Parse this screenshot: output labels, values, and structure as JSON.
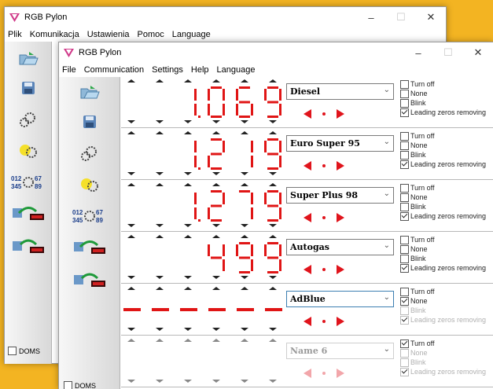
{
  "back_window": {
    "title": "RGB Pylon",
    "menu": [
      "Plik",
      "Komunikacja",
      "Ustawienia",
      "Pomoc",
      "Language"
    ],
    "doms_label": "DOMS"
  },
  "front_window": {
    "title": "RGB Pylon",
    "menu": [
      "File",
      "Communication",
      "Settings",
      "Help",
      "Language"
    ],
    "doms_label": "DOMS",
    "tools": [
      "open-folder-icon",
      "save-disk-icon",
      "settings-gears-icon",
      "bulb-gear-icon",
      "numeric-gear-icon",
      "send-to-display-icon",
      "read-from-display-icon"
    ],
    "rows": [
      {
        "price": "1.069",
        "fuel": "Diesel",
        "turn_off": false,
        "none": false,
        "blink": false,
        "leading_zeros": true,
        "enabled": true,
        "digits": true
      },
      {
        "price": "1.219",
        "fuel": "Euro Super 95",
        "turn_off": false,
        "none": false,
        "blink": false,
        "leading_zeros": true,
        "enabled": true,
        "digits": true
      },
      {
        "price": "1.279",
        "fuel": "Super Plus 98",
        "turn_off": false,
        "none": false,
        "blink": false,
        "leading_zeros": true,
        "enabled": true,
        "digits": true
      },
      {
        "price": "499",
        "fuel": "Autogas",
        "turn_off": false,
        "none": false,
        "blink": false,
        "leading_zeros": true,
        "enabled": true,
        "digits": true
      },
      {
        "price": "------",
        "fuel": "AdBlue",
        "turn_off": false,
        "none": true,
        "blink": false,
        "leading_zeros": true,
        "enabled": true,
        "digits": false,
        "focused": true
      },
      {
        "price": "",
        "fuel": "Name 6",
        "turn_off": true,
        "none": false,
        "blink": false,
        "leading_zeros": true,
        "enabled": false,
        "digits": false
      }
    ],
    "options": {
      "turn_off": "Turn off",
      "none": "None",
      "blink": "Blink",
      "leading_zeros": "Leading zeros removing"
    }
  },
  "colors": {
    "accent": "#e01515",
    "background": "#f3b422"
  }
}
